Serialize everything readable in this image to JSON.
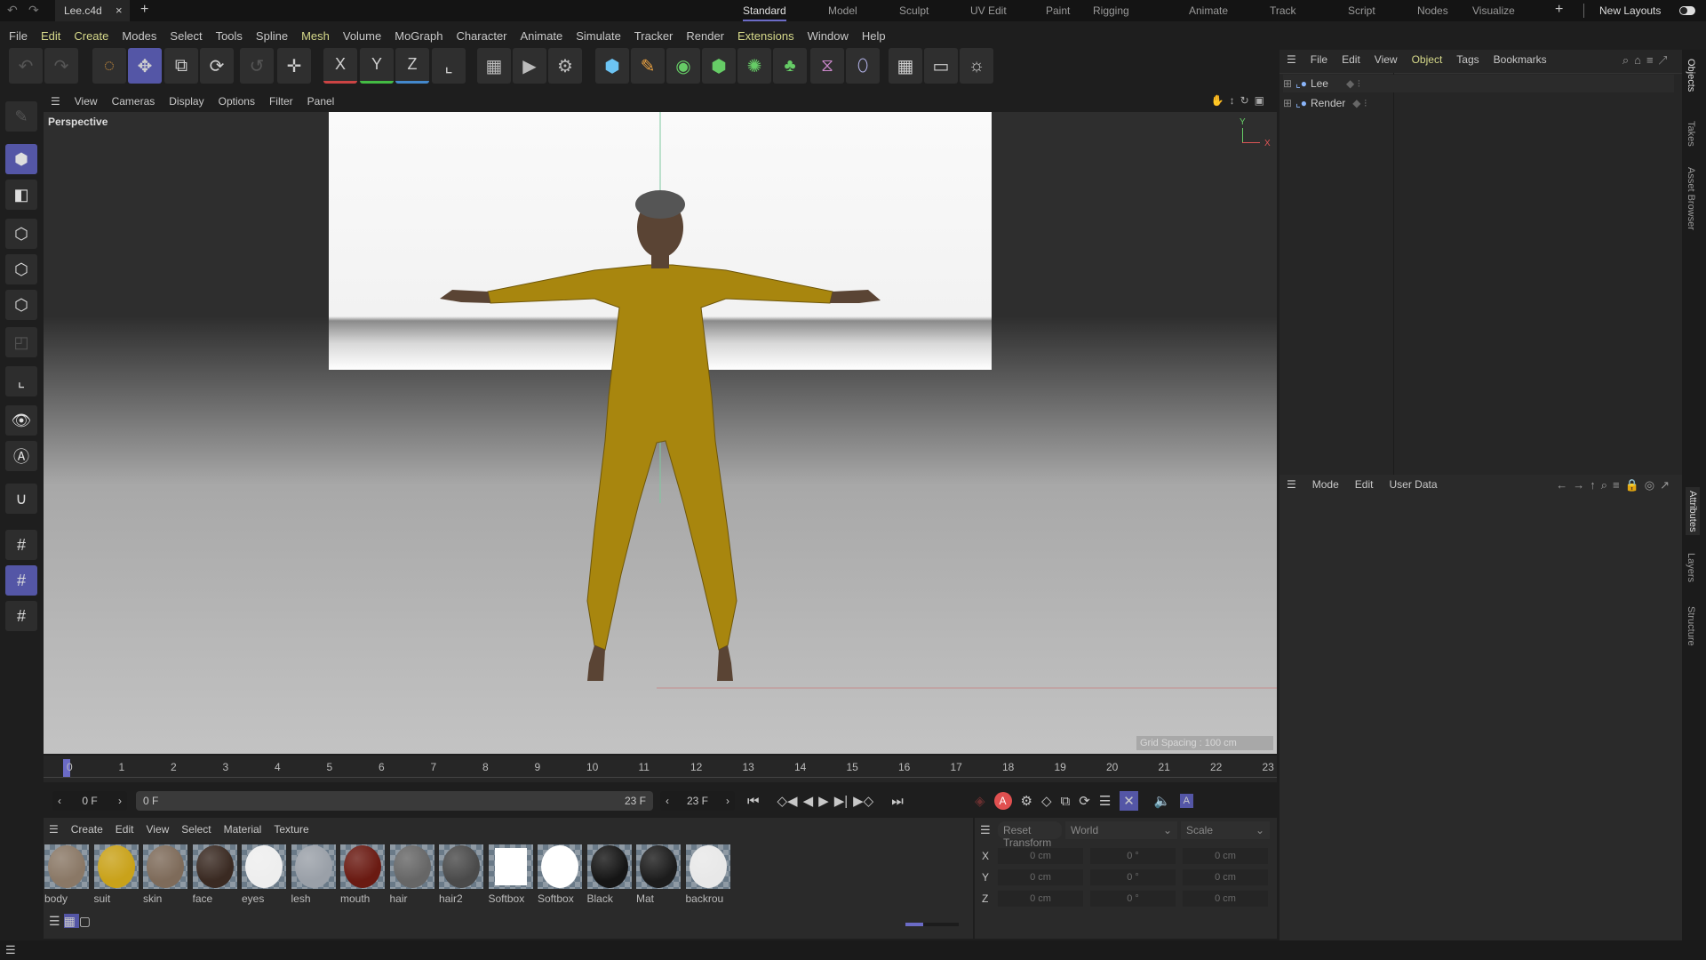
{
  "topbar": {
    "file_tab": "Lee.c4d",
    "layouts": [
      "Standard",
      "Model",
      "Sculpt",
      "UV Edit",
      "Paint",
      "Rigging",
      "Animate",
      "Track",
      "Script",
      "Nodes",
      "Visualize"
    ],
    "active_layout": "Standard",
    "new_layouts": "New Layouts"
  },
  "menu": [
    "File",
    "Edit",
    "Create",
    "Modes",
    "Select",
    "Tools",
    "Spline",
    "Mesh",
    "Volume",
    "MoGraph",
    "Character",
    "Animate",
    "Simulate",
    "Tracker",
    "Render",
    "Extensions",
    "Window",
    "Help"
  ],
  "toolbar": {
    "axis_x": "X",
    "axis_y": "Y",
    "axis_z": "Z"
  },
  "viewport": {
    "menu": [
      "View",
      "Cameras",
      "Display",
      "Options",
      "Filter",
      "Panel"
    ],
    "camera_label": "Perspective",
    "grid_spacing": "Grid Spacing : 100 cm",
    "axis_y": "Y",
    "axis_x": "X"
  },
  "timeline": {
    "ticks": [
      "0",
      "1",
      "2",
      "3",
      "4",
      "5",
      "6",
      "7",
      "8",
      "9",
      "10",
      "11",
      "12",
      "13",
      "14",
      "15",
      "16",
      "17",
      "18",
      "19",
      "20",
      "21",
      "22",
      "23"
    ],
    "current_frame": "0 F",
    "range_start": "0 F",
    "range_end": "23 F",
    "end_frame": "23 F"
  },
  "materials": {
    "menu": [
      "Create",
      "Edit",
      "View",
      "Select",
      "Material",
      "Texture"
    ],
    "items": [
      {
        "name": "body",
        "color": "#8a7866"
      },
      {
        "name": "suit",
        "color": "#c9a21a"
      },
      {
        "name": "skin",
        "color": "#7e6b5a"
      },
      {
        "name": "face",
        "color": "#3a2a22"
      },
      {
        "name": "eyes",
        "color": "#eeeeee"
      },
      {
        "name": "lesh",
        "color": "#9aa0a8"
      },
      {
        "name": "mouth",
        "color": "#6a1a12"
      },
      {
        "name": "hair",
        "color": "#666666"
      },
      {
        "name": "hair2",
        "color": "#4a4a4a"
      },
      {
        "name": "Softbox",
        "color": "#ffffff"
      },
      {
        "name": "Softbox",
        "color": "#ffffff"
      },
      {
        "name": "Black",
        "color": "#151515"
      },
      {
        "name": "Mat",
        "color": "#1c1c1c"
      },
      {
        "name": "backrou",
        "color": "#e8e8e8"
      }
    ]
  },
  "coords": {
    "reset": "Reset Transform",
    "space": "World",
    "mode": "Scale",
    "rows": [
      {
        "axis": "X",
        "pos": "0 cm",
        "rot": "0 °",
        "scale": "0 cm"
      },
      {
        "axis": "Y",
        "pos": "0 cm",
        "rot": "0 °",
        "scale": "0 cm"
      },
      {
        "axis": "Z",
        "pos": "0 cm",
        "rot": "0 °",
        "scale": "0 cm"
      }
    ]
  },
  "objects": {
    "menu": [
      "File",
      "Edit",
      "View",
      "Object",
      "Tags",
      "Bookmarks"
    ],
    "items": [
      "Lee",
      "Render"
    ]
  },
  "attributes": {
    "menu": [
      "Mode",
      "Edit",
      "User Data"
    ]
  },
  "side_tabs": [
    "Objects",
    "Takes",
    "Asset Browser",
    "Attributes",
    "Layers",
    "Structure"
  ],
  "colors": {
    "accent": "#5456a6",
    "highlight_menu": "#d6d98a",
    "suit": "#a8860e"
  }
}
